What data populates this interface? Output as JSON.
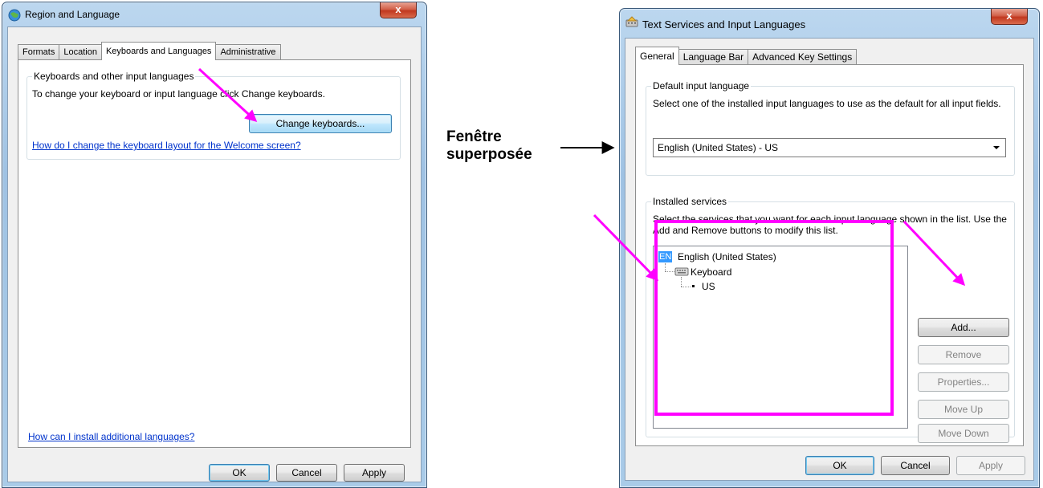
{
  "annotation": {
    "label_line1": "Fenêtre",
    "label_line2": "superposée",
    "accent_color": "#ff00ff"
  },
  "region_window": {
    "title": "Region and Language",
    "title_icon": "globe-region-icon",
    "close_label": "x",
    "tabs": [
      {
        "label": "Formats",
        "active": false
      },
      {
        "label": "Location",
        "active": false
      },
      {
        "label": "Keyboards and Languages",
        "active": true
      },
      {
        "label": "Administrative",
        "active": false
      }
    ],
    "group_title": "Keyboards and other input languages",
    "group_text": "To change your keyboard or input language click Change keyboards.",
    "change_keyboards_button": "Change keyboards...",
    "welcome_link": "How do I change the keyboard layout for the Welcome screen?",
    "install_link": "How can I install additional languages?",
    "ok_button": "OK",
    "cancel_button": "Cancel",
    "apply_button": "Apply"
  },
  "text_services_window": {
    "title": "Text Services and Input Languages",
    "title_icon": "keyboard-services-icon",
    "close_label": "x",
    "tabs": [
      {
        "label": "General",
        "active": true
      },
      {
        "label": "Language Bar",
        "active": false
      },
      {
        "label": "Advanced Key Settings",
        "active": false
      }
    ],
    "default_group_title": "Default input language",
    "default_group_text": "Select one of the installed input languages to use as the default for all input fields.",
    "default_language_value": "English (United States) - US",
    "installed_group_title": "Installed services",
    "installed_group_text": "Select the services that you want for each input language shown in the list. Use the Add and Remove buttons to modify this list.",
    "tree": {
      "language_badge": "EN",
      "language": "English (United States)",
      "category": "Keyboard",
      "layout": "US"
    },
    "add_button": "Add...",
    "remove_button": "Remove",
    "properties_button": "Properties...",
    "move_up_button": "Move Up",
    "move_down_button": "Move Down",
    "ok_button": "OK",
    "cancel_button": "Cancel",
    "apply_button": "Apply"
  }
}
